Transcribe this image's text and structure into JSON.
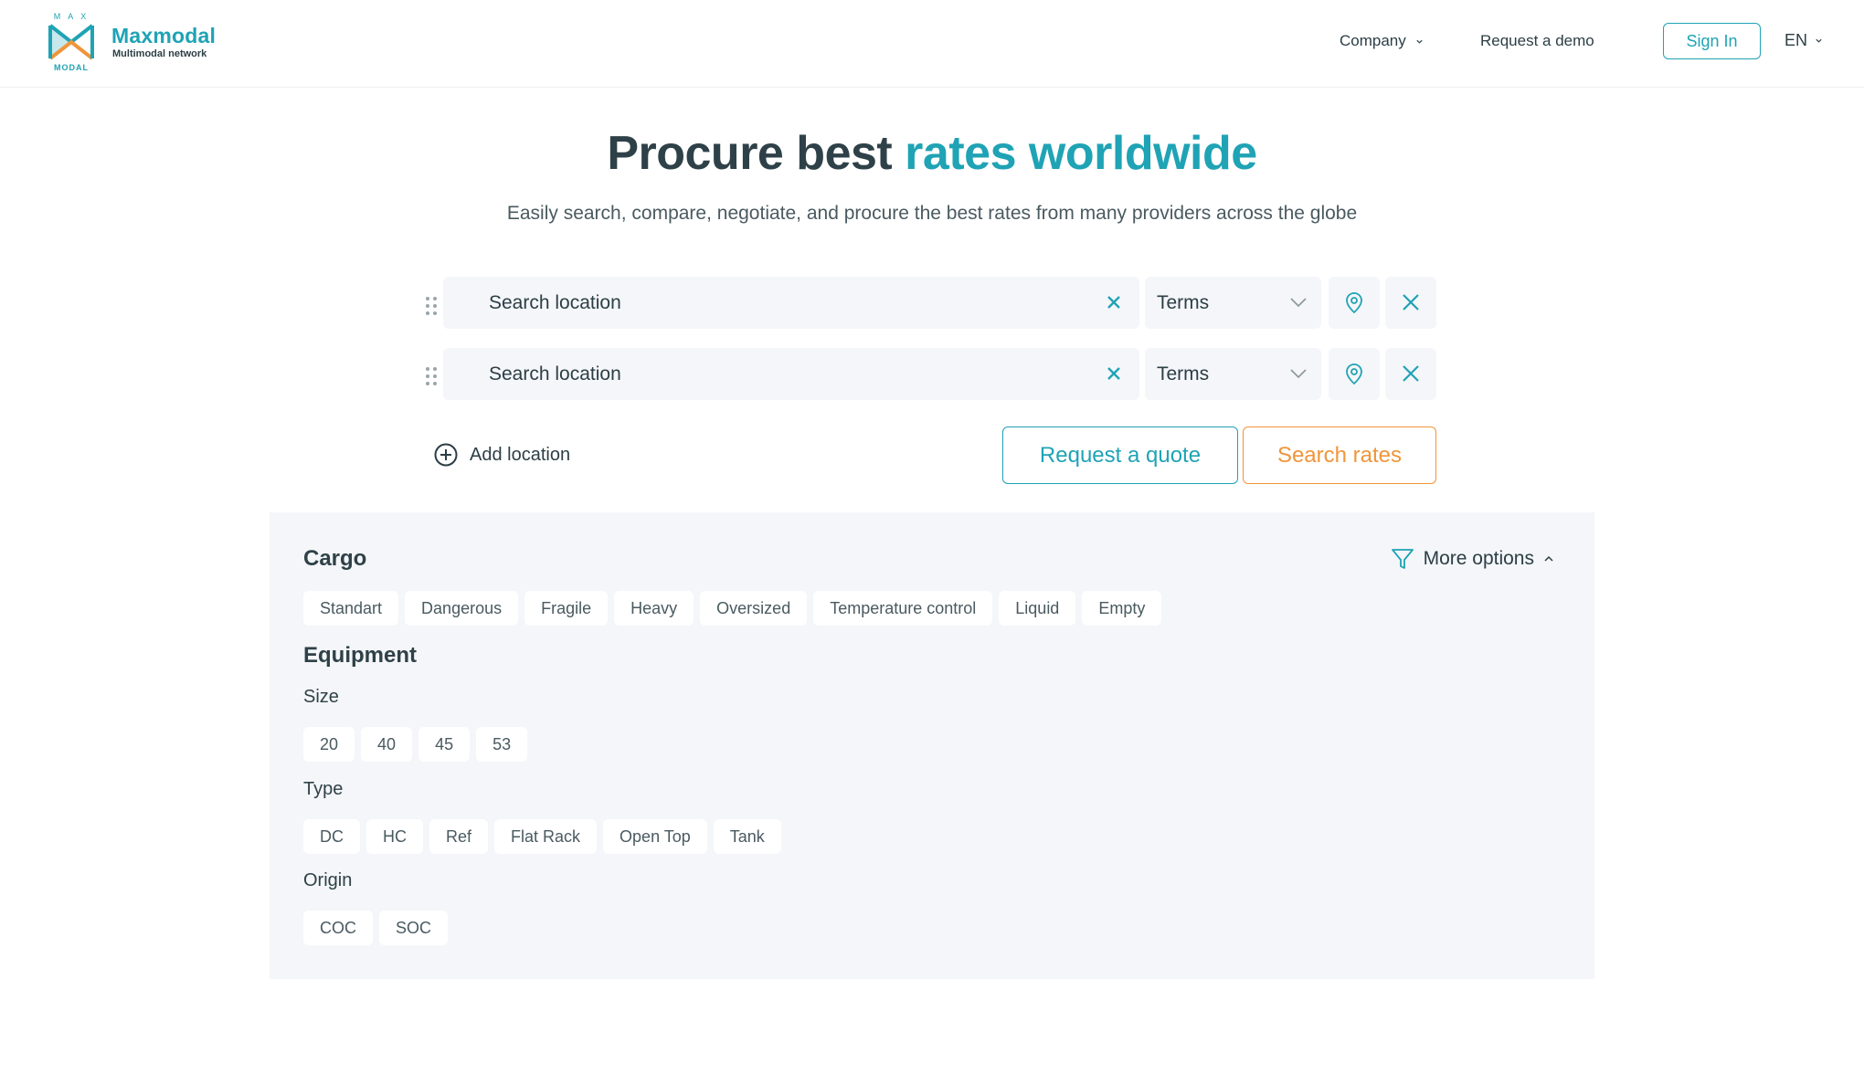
{
  "header": {
    "brand_name": "Maxmodal",
    "brand_sub": "Multimodal network",
    "logo_top": "M A X",
    "logo_bottom": "MODAL",
    "nav": {
      "company": "Company",
      "request_demo": "Request a demo",
      "sign_in": "Sign In",
      "language": "EN"
    }
  },
  "hero": {
    "title_main": "Procure best",
    "title_accent": "rates worldwide",
    "subtitle": "Easily search, compare, negotiate, and procure the best rates from many providers across the globe"
  },
  "locations": [
    {
      "placeholder": "Search location",
      "terms": "Terms"
    },
    {
      "placeholder": "Search location",
      "terms": "Terms"
    }
  ],
  "actions": {
    "add_location": "Add location",
    "request_quote": "Request a quote",
    "search_rates": "Search rates"
  },
  "options": {
    "more_options": "More options",
    "cargo_title": "Cargo",
    "cargo": [
      "Standart",
      "Dangerous",
      "Fragile",
      "Heavy",
      "Oversized",
      "Temperature control",
      "Liquid",
      "Empty"
    ],
    "equipment_title": "Equipment",
    "size_title": "Size",
    "size": [
      "20",
      "40",
      "45",
      "53"
    ],
    "type_title": "Type",
    "type": [
      "DC",
      "HC",
      "Ref",
      "Flat Rack",
      "Open Top",
      "Tank"
    ],
    "origin_title": "Origin",
    "origin": [
      "COC",
      "SOC"
    ]
  },
  "colors": {
    "accent": "#1fa3b5",
    "orange": "#f0953a",
    "text": "#2f4148",
    "panel_bg": "#f4f6f9"
  }
}
